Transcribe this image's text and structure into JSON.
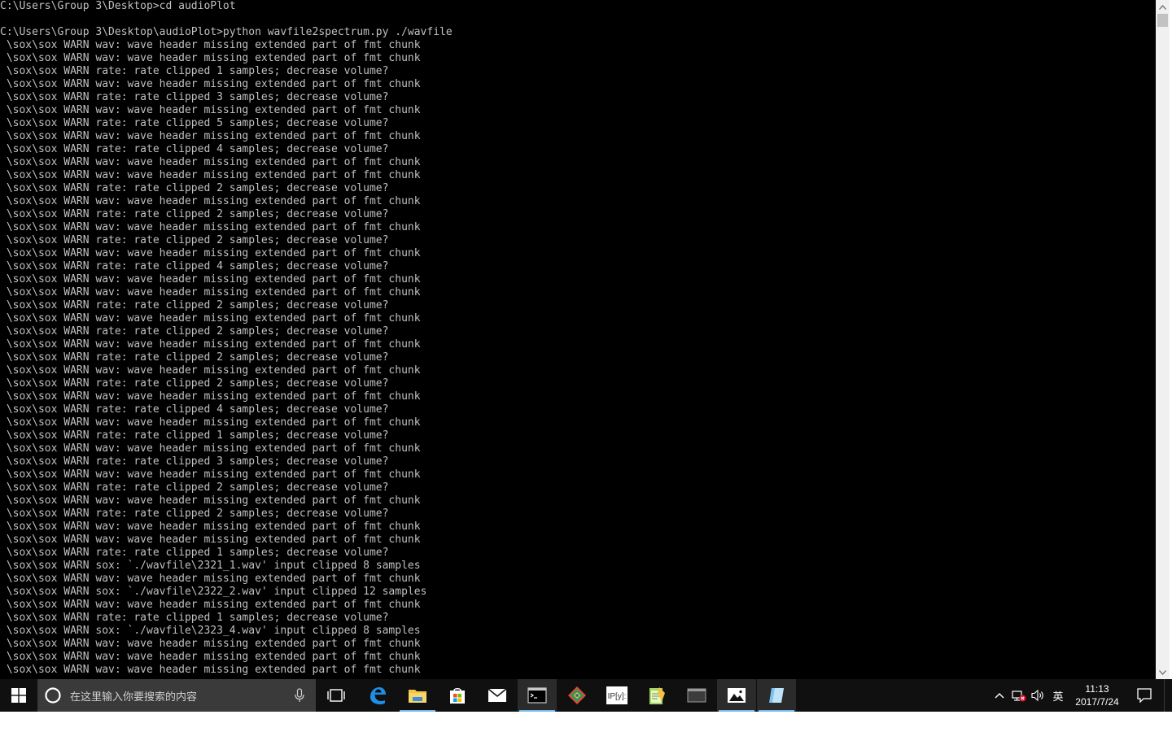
{
  "console": {
    "lines": [
      "C:\\Users\\Group 3\\Desktop>cd audioPlot",
      "",
      "C:\\Users\\Group 3\\Desktop\\audioPlot>python wavfile2spectrum.py ./wavfile",
      " \\sox\\sox WARN wav: wave header missing extended part of fmt chunk",
      " \\sox\\sox WARN wav: wave header missing extended part of fmt chunk",
      " \\sox\\sox WARN rate: rate clipped 1 samples; decrease volume?",
      " \\sox\\sox WARN wav: wave header missing extended part of fmt chunk",
      " \\sox\\sox WARN rate: rate clipped 3 samples; decrease volume?",
      " \\sox\\sox WARN wav: wave header missing extended part of fmt chunk",
      " \\sox\\sox WARN rate: rate clipped 5 samples; decrease volume?",
      " \\sox\\sox WARN wav: wave header missing extended part of fmt chunk",
      " \\sox\\sox WARN rate: rate clipped 4 samples; decrease volume?",
      " \\sox\\sox WARN wav: wave header missing extended part of fmt chunk",
      " \\sox\\sox WARN wav: wave header missing extended part of fmt chunk",
      " \\sox\\sox WARN rate: rate clipped 2 samples; decrease volume?",
      " \\sox\\sox WARN wav: wave header missing extended part of fmt chunk",
      " \\sox\\sox WARN rate: rate clipped 2 samples; decrease volume?",
      " \\sox\\sox WARN wav: wave header missing extended part of fmt chunk",
      " \\sox\\sox WARN rate: rate clipped 2 samples; decrease volume?",
      " \\sox\\sox WARN wav: wave header missing extended part of fmt chunk",
      " \\sox\\sox WARN rate: rate clipped 4 samples; decrease volume?",
      " \\sox\\sox WARN wav: wave header missing extended part of fmt chunk",
      " \\sox\\sox WARN wav: wave header missing extended part of fmt chunk",
      " \\sox\\sox WARN rate: rate clipped 2 samples; decrease volume?",
      " \\sox\\sox WARN wav: wave header missing extended part of fmt chunk",
      " \\sox\\sox WARN rate: rate clipped 2 samples; decrease volume?",
      " \\sox\\sox WARN wav: wave header missing extended part of fmt chunk",
      " \\sox\\sox WARN rate: rate clipped 2 samples; decrease volume?",
      " \\sox\\sox WARN wav: wave header missing extended part of fmt chunk",
      " \\sox\\sox WARN rate: rate clipped 2 samples; decrease volume?",
      " \\sox\\sox WARN wav: wave header missing extended part of fmt chunk",
      " \\sox\\sox WARN rate: rate clipped 4 samples; decrease volume?",
      " \\sox\\sox WARN wav: wave header missing extended part of fmt chunk",
      " \\sox\\sox WARN rate: rate clipped 1 samples; decrease volume?",
      " \\sox\\sox WARN wav: wave header missing extended part of fmt chunk",
      " \\sox\\sox WARN rate: rate clipped 3 samples; decrease volume?",
      " \\sox\\sox WARN wav: wave header missing extended part of fmt chunk",
      " \\sox\\sox WARN rate: rate clipped 2 samples; decrease volume?",
      " \\sox\\sox WARN wav: wave header missing extended part of fmt chunk",
      " \\sox\\sox WARN rate: rate clipped 2 samples; decrease volume?",
      " \\sox\\sox WARN wav: wave header missing extended part of fmt chunk",
      " \\sox\\sox WARN wav: wave header missing extended part of fmt chunk",
      " \\sox\\sox WARN rate: rate clipped 1 samples; decrease volume?",
      " \\sox\\sox WARN sox: `./wavfile\\2321_1.wav' input clipped 8 samples",
      " \\sox\\sox WARN wav: wave header missing extended part of fmt chunk",
      " \\sox\\sox WARN sox: `./wavfile\\2322_2.wav' input clipped 12 samples",
      " \\sox\\sox WARN wav: wave header missing extended part of fmt chunk",
      " \\sox\\sox WARN rate: rate clipped 1 samples; decrease volume?",
      " \\sox\\sox WARN sox: `./wavfile\\2323_4.wav' input clipped 8 samples",
      " \\sox\\sox WARN wav: wave header missing extended part of fmt chunk",
      " \\sox\\sox WARN wav: wave header missing extended part of fmt chunk",
      " \\sox\\sox WARN wav: wave header missing extended part of fmt chunk"
    ]
  },
  "taskbar": {
    "search_placeholder": "在这里输入你要搜索的内容",
    "tray_ime": "英",
    "clock_time": "11:13",
    "clock_date": "2017/7/24",
    "pinned_apps": [
      {
        "name": "Microsoft Edge",
        "icon": "edge-icon"
      },
      {
        "name": "File Explorer",
        "icon": "folder-icon"
      },
      {
        "name": "Store",
        "icon": "store-icon"
      },
      {
        "name": "Mail",
        "icon": "mail-icon"
      },
      {
        "name": "Command Prompt",
        "icon": "cmd-icon",
        "active": true
      },
      {
        "name": "Git",
        "icon": "git-icon"
      },
      {
        "name": "IPython",
        "icon": "ipython-icon"
      },
      {
        "name": "Notepad++",
        "icon": "notepad-icon"
      },
      {
        "name": "Window",
        "icon": "window-icon"
      },
      {
        "name": "Photos",
        "icon": "photos-icon",
        "active": true
      },
      {
        "name": "App",
        "icon": "blue-app-icon",
        "active": true
      }
    ],
    "colors": {
      "taskbar_bg": "#101010",
      "accent": "#76b9ed",
      "console_text": "#c0c0c0",
      "console_bg": "#000000"
    }
  }
}
